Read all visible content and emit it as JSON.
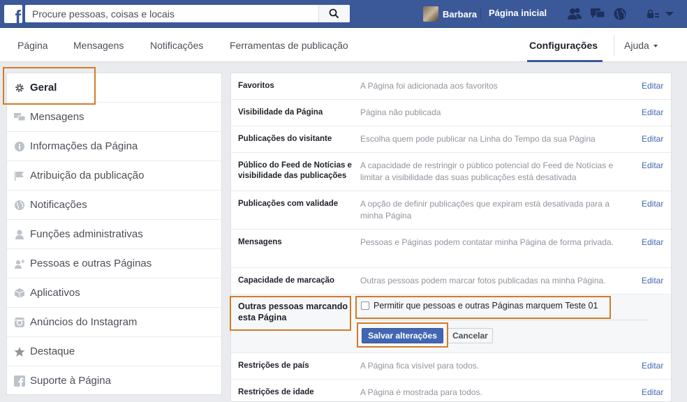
{
  "topbar": {
    "search_placeholder": "Procure pessoas, coisas e locais",
    "user_name": "Barbara",
    "home_label": "Página inicial"
  },
  "tabs": {
    "items": [
      "Página",
      "Mensagens",
      "Notificações",
      "Ferramentas de publicação"
    ],
    "active": "Configurações",
    "help": "Ajuda"
  },
  "sidebar": {
    "items": [
      {
        "label": "Geral",
        "icon": "gear-icon"
      },
      {
        "label": "Mensagens",
        "icon": "messages-icon"
      },
      {
        "label": "Informações da Página",
        "icon": "info-icon"
      },
      {
        "label": "Atribuição da publicação",
        "icon": "flag-icon"
      },
      {
        "label": "Notificações",
        "icon": "globe-icon"
      },
      {
        "label": "Funções administrativas",
        "icon": "person-icon"
      },
      {
        "label": "Pessoas e outras Páginas",
        "icon": "people-plus-icon"
      },
      {
        "label": "Aplicativos",
        "icon": "cube-icon"
      },
      {
        "label": "Anúncios do Instagram",
        "icon": "instagram-icon"
      },
      {
        "label": "Destaque",
        "icon": "star-icon"
      },
      {
        "label": "Suporte à Página",
        "icon": "facebook-icon"
      }
    ]
  },
  "settings": {
    "edit_label": "Editar",
    "rows": [
      {
        "name": "Favoritos",
        "value": "A Página foi adicionada aos favoritos"
      },
      {
        "name": "Visibilidade da Página",
        "value": "Página não publicada"
      },
      {
        "name": "Publicações do visitante",
        "value": "Escolha quem pode publicar na Linha do Tempo da sua Página"
      },
      {
        "name": "Público do Feed de Notícias e visibilidade das publicações",
        "value": "A capacidade de restringir o público potencial do Feed de Notícias e limitar a visibilidade das suas publicações está desativada"
      },
      {
        "name": "Publicações com validade",
        "value": "A opção de definir publicações que expiram está desativada para a minha Página"
      },
      {
        "name": "Mensagens",
        "value": "Pessoas e Páginas podem contatar minha Página de forma privada."
      },
      {
        "name": "Capacidade de marcação",
        "value": "Outras pessoas podem marcar fotos publicadas na minha Página."
      }
    ],
    "expanded": {
      "name": "Outras pessoas marcando esta Página",
      "checkbox_label": "Permitir que pessoas e outras Páginas marquem Teste 01",
      "checked": false,
      "save_label": "Salvar alterações",
      "cancel_label": "Cancelar"
    },
    "rows_after": [
      {
        "name": "Restrições de país",
        "value": "A Página fica visível para todos."
      },
      {
        "name": "Restrições de idade",
        "value": "A Página é mostrada para todos."
      }
    ]
  },
  "colors": {
    "fb_blue": "#3b5998",
    "link_blue": "#4267b2",
    "highlight_orange": "#d17c2a"
  }
}
